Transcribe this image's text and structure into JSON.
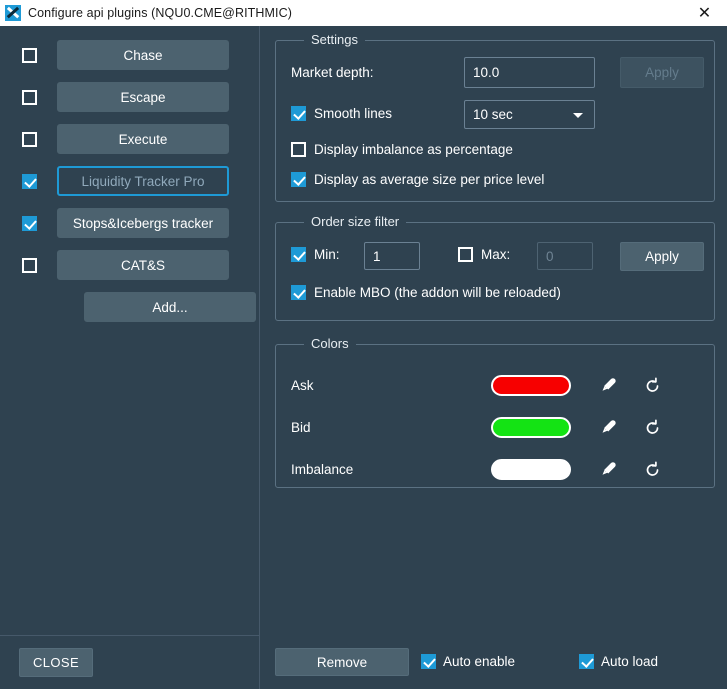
{
  "window": {
    "title": "Configure api plugins (NQU0.CME@RITHMIC)",
    "app_icon": "x-logo-icon",
    "close_label": "✕",
    "accent_color": "#1e9ad6",
    "background_color": "#2f4250"
  },
  "sidebar": {
    "plugins": [
      {
        "label": "Chase",
        "checked": false,
        "selected": false
      },
      {
        "label": "Escape",
        "checked": false,
        "selected": false
      },
      {
        "label": "Execute",
        "checked": false,
        "selected": false
      },
      {
        "label": "Liquidity Tracker Pro",
        "checked": true,
        "selected": true
      },
      {
        "label": "Stops&Icebergs tracker",
        "checked": true,
        "selected": false
      },
      {
        "label": "CAT&S",
        "checked": false,
        "selected": false
      }
    ],
    "add_label": "Add...",
    "close_label": "CLOSE"
  },
  "settings": {
    "group_title": "Settings",
    "market_depth_label": "Market depth:",
    "market_depth_value": "10.0",
    "apply_label": "Apply",
    "apply_enabled": false,
    "smooth_lines_label": "Smooth lines",
    "smooth_lines_checked": true,
    "interval_value": "10 sec",
    "imbalance_pct_label": "Display imbalance as percentage",
    "imbalance_pct_checked": false,
    "avg_size_label": "Display as average size per price level",
    "avg_size_checked": true
  },
  "order_size_filter": {
    "group_title": "Order size filter",
    "min_label": "Min:",
    "min_checked": true,
    "min_value": "1",
    "max_label": "Max:",
    "max_checked": false,
    "max_value": "0",
    "apply_label": "Apply",
    "apply_enabled": true,
    "enable_mbo_label": "Enable MBO (the addon will be reloaded)",
    "enable_mbo_checked": true
  },
  "colors": {
    "group_title": "Colors",
    "rows": [
      {
        "name": "Ask",
        "color": "#f70000"
      },
      {
        "name": "Bid",
        "color": "#14e314"
      },
      {
        "name": "Imbalance",
        "color": "#ffffff"
      }
    ],
    "pick_icon": "eyedropper-icon",
    "reset_icon": "reset-arrow-icon"
  },
  "footer": {
    "remove_label": "Remove",
    "auto_enable_label": "Auto enable",
    "auto_enable_checked": true,
    "auto_load_label": "Auto load",
    "auto_load_checked": true
  }
}
